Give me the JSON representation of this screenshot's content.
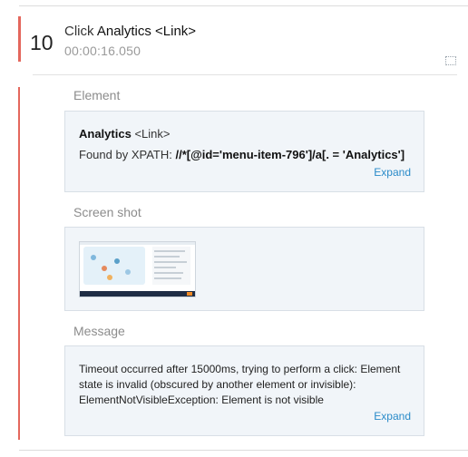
{
  "step": {
    "number": "10",
    "action": "Click",
    "target": "Analytics <Link>",
    "time": "00:00:16.050",
    "expand_icon": "expand-corners-icon"
  },
  "element": {
    "label": "Element",
    "name": "Analytics",
    "tag": "<Link>",
    "found_by": "Found by XPATH:",
    "xpath": "//*[@id='menu-item-796']/a[. = 'Analytics']",
    "expand": "Expand"
  },
  "screenshot": {
    "label": "Screen shot",
    "thumbnail_icon": "screenshot-thumbnail"
  },
  "message": {
    "label": "Message",
    "text": "Timeout occurred after 15000ms, trying to perform a click: Element state is invalid (obscured by another element or invisible): ElementNotVisibleException: Element is not visible",
    "expand": "Expand"
  },
  "colors": {
    "accent": "#e4675d",
    "link": "#2a8bc9",
    "box_bg": "#f1f5f9"
  }
}
